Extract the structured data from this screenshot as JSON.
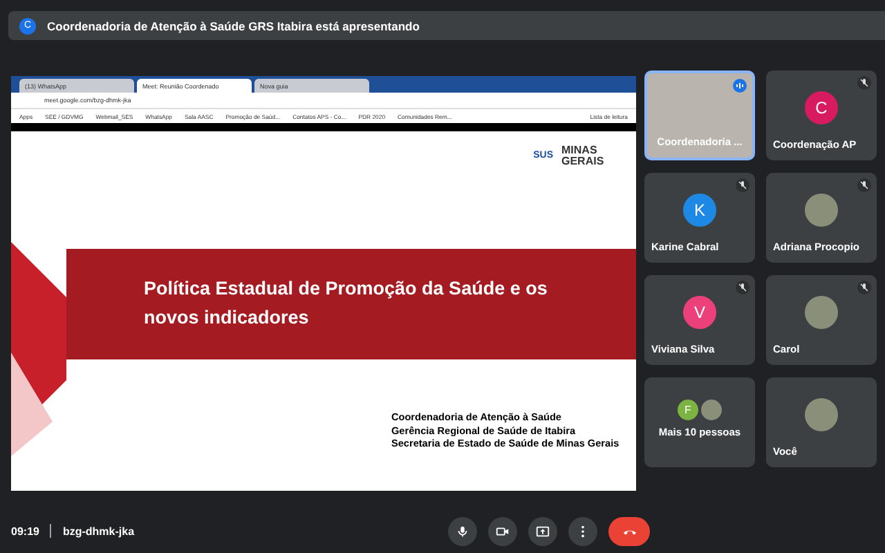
{
  "banner": {
    "avatar_letter": "C",
    "text": "Coordenadoria de Atenção à Saúde GRS Itabira está apresentando"
  },
  "shared_screen": {
    "browser": {
      "tabs": [
        {
          "title": "(13) WhatsApp",
          "selected": false
        },
        {
          "title": "Meet: Reunião Coordenado",
          "selected": true
        },
        {
          "title": "Nova guia",
          "selected": false
        }
      ],
      "address": "meet.google.com/bzg-dhmk-jka",
      "bookmarks": [
        "Apps",
        "SEE / GDVMG",
        "Webmail_SES",
        "WhatsApp",
        "Sala AASC",
        "Promoção de Saúd...",
        "Contatos APS - Co...",
        "PDR 2020",
        "Comunidades Rem..."
      ],
      "reading_list": "Lista de leitura"
    },
    "slide": {
      "logos": [
        "SUS",
        "MINAS GERAIS"
      ],
      "title": "Política Estadual de Promoção da Saúde e os novos indicadores",
      "footer_lines": [
        "Coordenadoria de Atenção à Saúde",
        "Gerência Regional de Saúde de Itabira",
        "Secretaria de Estado de Saúde de Minas Gerais"
      ]
    }
  },
  "participants": [
    {
      "name": "Coordenadoria ...",
      "kind": "video",
      "speaking": true,
      "muted": false
    },
    {
      "name": "Coordenação AP",
      "kind": "letter",
      "letter": "C",
      "color": "#d81b60",
      "speaking": false,
      "muted": true
    },
    {
      "name": "Karine Cabral",
      "kind": "letter",
      "letter": "K",
      "color": "#1e88e5",
      "speaking": false,
      "muted": true
    },
    {
      "name": "Adriana Procopio",
      "kind": "photo",
      "speaking": false,
      "muted": true
    },
    {
      "name": "Viviana Silva",
      "kind": "letter",
      "letter": "V",
      "color": "#ec407a",
      "speaking": false,
      "muted": true
    },
    {
      "name": "Carol",
      "kind": "photo",
      "speaking": false,
      "muted": true
    },
    {
      "name": "Mais 10 pessoas",
      "kind": "group",
      "letter": "F",
      "color": "#7cb342",
      "speaking": false,
      "muted": false
    },
    {
      "name": "Você",
      "kind": "photo",
      "speaking": false,
      "muted": false
    }
  ],
  "controls": {
    "time": "09:19",
    "meeting_code": "bzg-dhmk-jka",
    "buttons": [
      {
        "kind": "mic"
      },
      {
        "kind": "camera"
      },
      {
        "kind": "present"
      },
      {
        "kind": "more"
      },
      {
        "kind": "hangup"
      }
    ]
  }
}
